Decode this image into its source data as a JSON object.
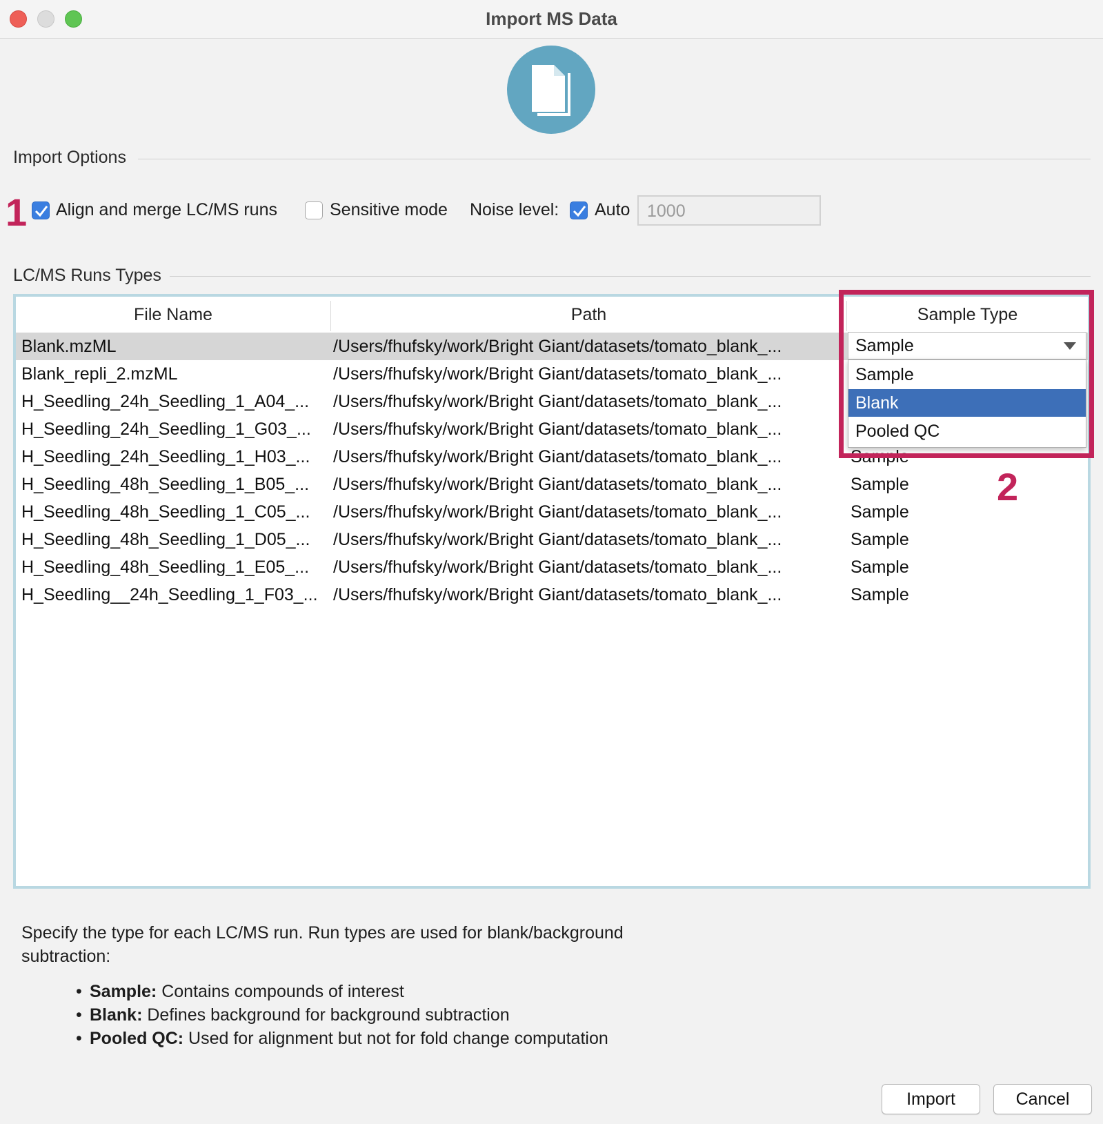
{
  "window": {
    "title": "Import MS Data"
  },
  "icon": {
    "name": "document-copy-icon",
    "color": "#62a6c1"
  },
  "import_options": {
    "label": "Import Options",
    "align_merge": {
      "label": "Align and merge LC/MS runs",
      "checked": true
    },
    "sensitive_mode": {
      "label": "Sensitive mode",
      "checked": false
    },
    "noise_level": {
      "label": "Noise level:",
      "auto_label": "Auto",
      "auto_checked": true,
      "value": "1000"
    }
  },
  "annotations": {
    "one": "1",
    "two": "2",
    "color": "#c2245a"
  },
  "runs_types": {
    "label": "LC/MS Runs Types",
    "columns": [
      "File Name",
      "Path",
      "Sample Type"
    ],
    "rows": [
      {
        "file": "Blank.mzML",
        "path": "/Users/fhufsky/work/Bright Giant/datasets/tomato_blank_...",
        "type": "Sample"
      },
      {
        "file": "Blank_repli_2.mzML",
        "path": "/Users/fhufsky/work/Bright Giant/datasets/tomato_blank_...",
        "type": "Sample"
      },
      {
        "file": "H_Seedling_24h_Seedling_1_A04_...",
        "path": "/Users/fhufsky/work/Bright Giant/datasets/tomato_blank_...",
        "type": "Sample"
      },
      {
        "file": "H_Seedling_24h_Seedling_1_G03_...",
        "path": "/Users/fhufsky/work/Bright Giant/datasets/tomato_blank_...",
        "type": "Sample"
      },
      {
        "file": "H_Seedling_24h_Seedling_1_H03_...",
        "path": "/Users/fhufsky/work/Bright Giant/datasets/tomato_blank_...",
        "type": "Sample"
      },
      {
        "file": "H_Seedling_48h_Seedling_1_B05_...",
        "path": "/Users/fhufsky/work/Bright Giant/datasets/tomato_blank_...",
        "type": "Sample"
      },
      {
        "file": "H_Seedling_48h_Seedling_1_C05_...",
        "path": "/Users/fhufsky/work/Bright Giant/datasets/tomato_blank_...",
        "type": "Sample"
      },
      {
        "file": "H_Seedling_48h_Seedling_1_D05_...",
        "path": "/Users/fhufsky/work/Bright Giant/datasets/tomato_blank_...",
        "type": "Sample"
      },
      {
        "file": "H_Seedling_48h_Seedling_1_E05_...",
        "path": "/Users/fhufsky/work/Bright Giant/datasets/tomato_blank_...",
        "type": "Sample"
      },
      {
        "file": "H_Seedling__24h_Seedling_1_F03_...",
        "path": "/Users/fhufsky/work/Bright Giant/datasets/tomato_blank_...",
        "type": "Sample"
      }
    ],
    "combo_value": "Sample",
    "dropdown_options": [
      "Sample",
      "Blank",
      "Pooled QC"
    ],
    "dropdown_highlighted": "Blank"
  },
  "description": {
    "text": "Specify the type for each LC/MS run. Run types are used for blank/background subtraction:",
    "bullets": [
      {
        "term": "Sample:",
        "text": " Contains compounds of interest"
      },
      {
        "term": "Blank:",
        "text": " Defines background for background subtraction"
      },
      {
        "term": "Pooled QC:",
        "text": " Used for alignment but not for fold change computation"
      }
    ]
  },
  "buttons": {
    "import": "Import",
    "cancel": "Cancel"
  }
}
